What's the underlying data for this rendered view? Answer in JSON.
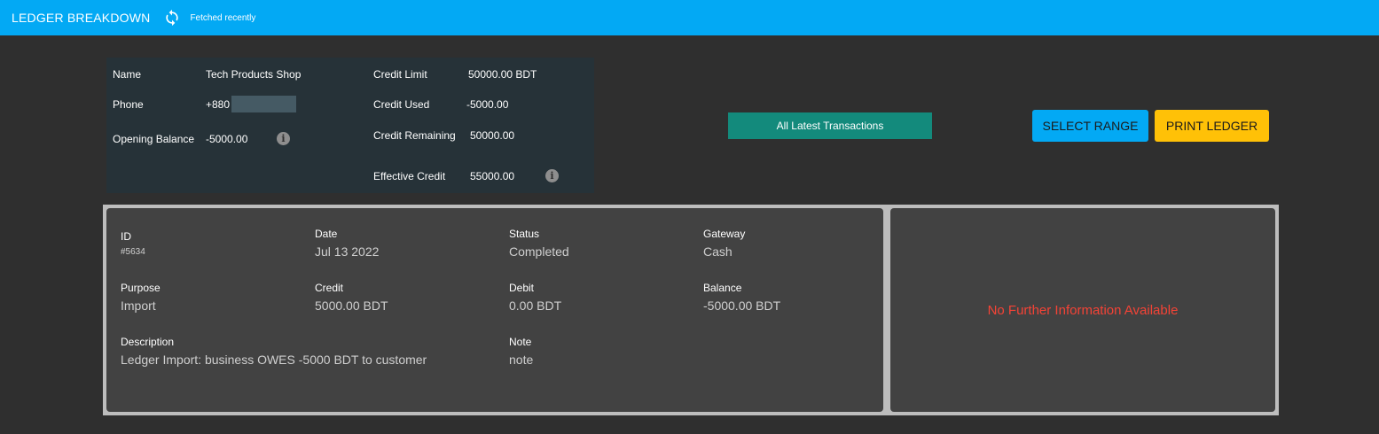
{
  "header": {
    "title": "LEDGER BREAKDOWN",
    "fetched_status": "Fetched recently"
  },
  "customer": {
    "name_label": "Name",
    "name_value": "Tech Products Shop",
    "phone_label": "Phone",
    "phone_value": "+880",
    "opening_balance_label": "Opening Balance",
    "opening_balance_value": "-5000.00",
    "credit_limit_label": "Credit Limit",
    "credit_limit_value": "50000.00 BDT",
    "credit_used_label": "Credit Used",
    "credit_used_value": "-5000.00",
    "credit_remaining_label": "Credit Remaining",
    "credit_remaining_value": "50000.00",
    "effective_credit_label": "Effective Credit",
    "effective_credit_value": "55000.00"
  },
  "actions": {
    "latest_label": "All Latest Transactions",
    "select_range_label": "SELECT RANGE",
    "print_ledger_label": "PRINT LEDGER"
  },
  "transaction": {
    "id_label": "ID",
    "id_value": "#5634",
    "date_label": "Date",
    "date_value": "Jul 13 2022",
    "status_label": "Status",
    "status_value": "Completed",
    "gateway_label": "Gateway",
    "gateway_value": "Cash",
    "purpose_label": "Purpose",
    "purpose_value": "Import",
    "credit_label": "Credit",
    "credit_value": "5000.00 BDT",
    "debit_label": "Debit",
    "debit_value": "0.00 BDT",
    "balance_label": "Balance",
    "balance_value": "-5000.00 BDT",
    "description_label": "Description",
    "description_value": "Ledger Import: business OWES -5000 BDT to customer",
    "note_label": "Note",
    "note_value": "note"
  },
  "side_panel": {
    "message": "No Further Information Available"
  },
  "colors": {
    "topbar": "#03a9f4",
    "background": "#2f2f2f",
    "info_card": "#263238",
    "latest_button": "#138a7c",
    "select_range": "#03a9f4",
    "print_ledger": "#ffc107",
    "no_info_text": "#f44336"
  },
  "icons": {
    "refresh": "refresh-icon",
    "info": "info-icon"
  }
}
